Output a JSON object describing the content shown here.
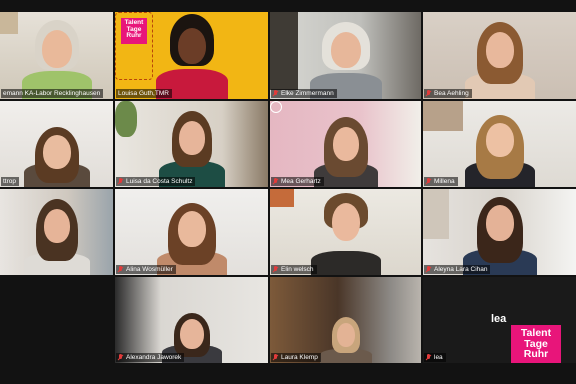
{
  "meeting": {
    "participants": [
      {
        "name": "emann KA-Labor Recklinghausen",
        "muted": false
      },
      {
        "name": "Louisa Guth,TMR",
        "muted": false
      },
      {
        "name": "Elke Zimmermann",
        "muted": true
      },
      {
        "name": "Bea Aehling",
        "muted": true
      },
      {
        "name": "ttrop",
        "muted": true
      },
      {
        "name": "Luisa da Costa Schultz",
        "muted": true
      },
      {
        "name": "Mea Gerhartz",
        "muted": true
      },
      {
        "name": "Millena",
        "muted": true
      },
      {
        "name": "Alina Wosmüller",
        "muted": true
      },
      {
        "name": "Elin welsch",
        "muted": true
      },
      {
        "name": "Aleyna Lara Cihan",
        "muted": true
      },
      {
        "name": "Alexandra Jaworek",
        "muted": true
      },
      {
        "name": "Laura Klemp",
        "muted": true
      },
      {
        "name": "lea",
        "muted": true
      }
    ],
    "avatar_tile": {
      "display_name": "lea"
    },
    "active_speaker_index": 1
  },
  "branding": {
    "logo_lines": [
      "Talent",
      "Tage",
      "Ruhr"
    ],
    "small_logo_lines": [
      "Talent",
      "Tage",
      "Ruhr"
    ],
    "logo_color": "#e8157a",
    "slide_background": "#f2b614",
    "highlight_color": "#f3d53a"
  }
}
